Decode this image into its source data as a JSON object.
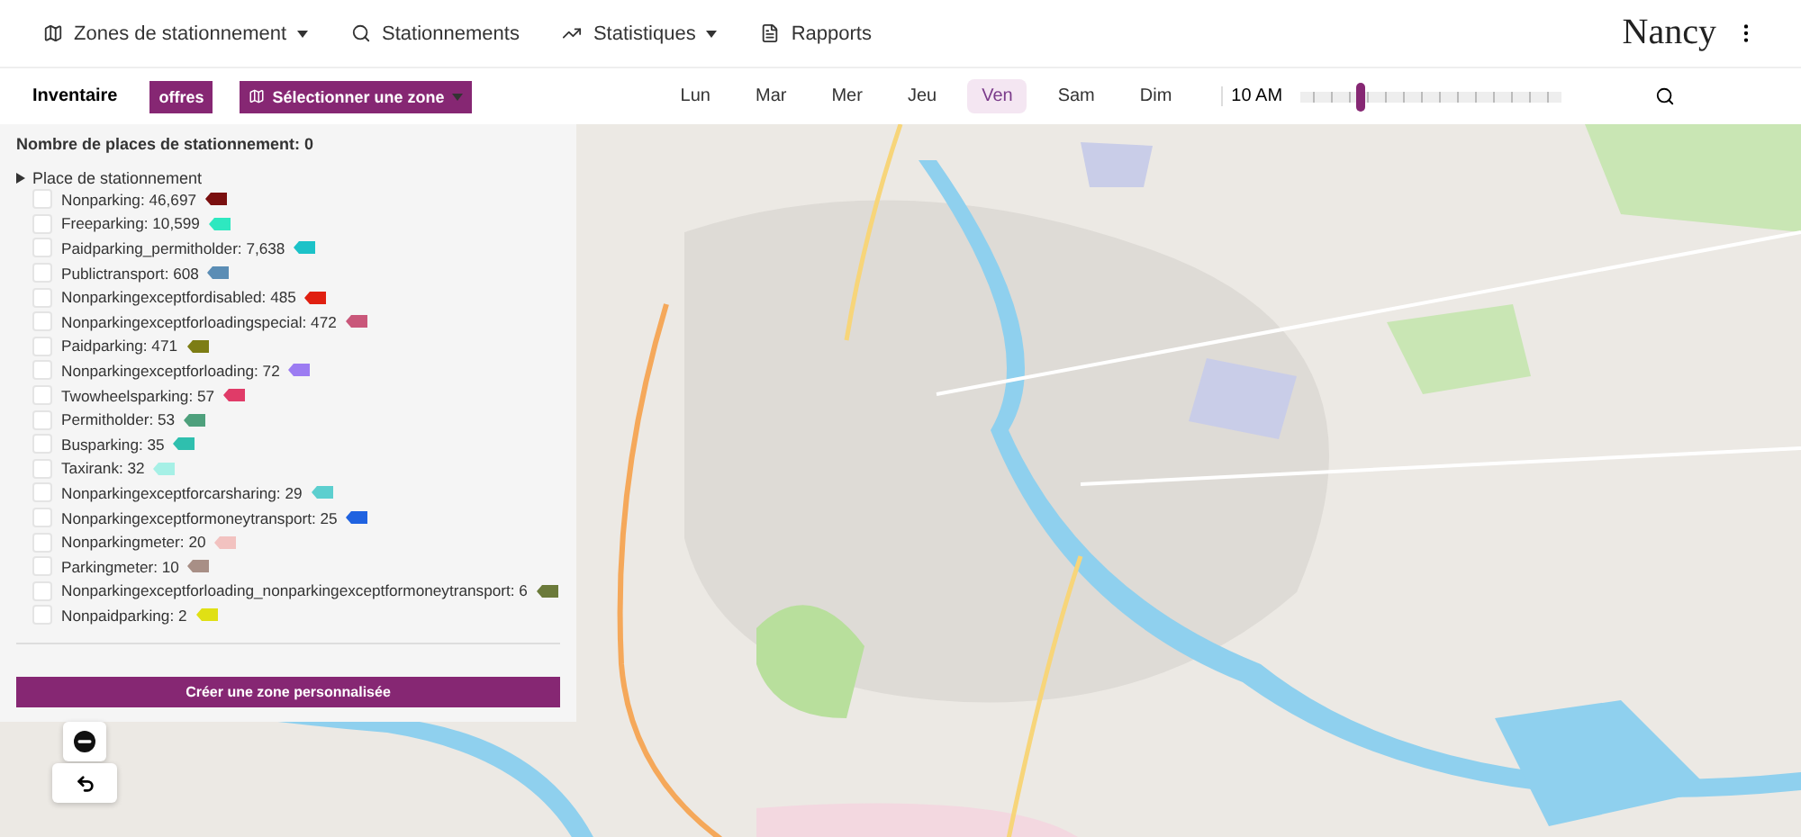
{
  "nav": {
    "items": [
      {
        "kind": "zones",
        "label": "Zones de stationnement",
        "dropdown": true
      },
      {
        "kind": "search",
        "label": "Stationnements",
        "dropdown": false
      },
      {
        "kind": "stats",
        "label": "Statistiques",
        "dropdown": true
      },
      {
        "kind": "report",
        "label": "Rapports",
        "dropdown": false
      }
    ],
    "logo": "Nancy"
  },
  "toolbar": {
    "title": "Inventaire",
    "offers_button": "offres",
    "zone_button": "Sélectionner une zone",
    "days": [
      {
        "label": "Lun",
        "selected": false
      },
      {
        "label": "Mar",
        "selected": false
      },
      {
        "label": "Mer",
        "selected": false
      },
      {
        "label": "Jeu",
        "selected": false
      },
      {
        "label": "Ven",
        "selected": true
      },
      {
        "label": "Sam",
        "selected": false
      },
      {
        "label": "Dim",
        "selected": false
      }
    ],
    "time": {
      "label": "10 AM",
      "level": 0.23
    }
  },
  "panel": {
    "count": "Nombre de places de stationnement: 0",
    "group": {
      "label": "Place de stationnement",
      "expanded": true,
      "items": [
        {
          "label": "Nonparking: 46,697",
          "checked": false,
          "color": "#7a0f0f"
        },
        {
          "label": "Freeparking: 10,599",
          "checked": false,
          "color": "#2ee8c0"
        },
        {
          "label": "Paidparking_permitholder: 7,638",
          "checked": false,
          "color": "#1cc2c8"
        },
        {
          "label": "Publictransport: 608",
          "checked": false,
          "color": "#5b8db5"
        },
        {
          "label": "Nonparkingexceptfordisabled: 485",
          "checked": false,
          "color": "#e01f10"
        },
        {
          "label": "Nonparkingexceptforloadingspecial: 472",
          "checked": false,
          "color": "#c9577a"
        },
        {
          "label": "Paidparking: 471",
          "checked": false,
          "color": "#7d7d14"
        },
        {
          "label": "Nonparkingexceptforloading: 72",
          "checked": false,
          "color": "#9c7cf2"
        },
        {
          "label": "Twowheelsparking: 57",
          "checked": false,
          "color": "#e03b68"
        },
        {
          "label": "Permitholder: 53",
          "checked": false,
          "color": "#4ea07c"
        },
        {
          "label": "Busparking: 35",
          "checked": false,
          "color": "#2fbfae"
        },
        {
          "label": "Taxirank: 32",
          "checked": false,
          "color": "#a6f0e6"
        },
        {
          "label": "Nonparkingexceptforcarsharing: 29",
          "checked": false,
          "color": "#5ccfcf"
        },
        {
          "label": "Nonparkingexceptformoneytransport: 25",
          "checked": false,
          "color": "#1f62e0"
        },
        {
          "label": "Nonparkingmeter: 20",
          "checked": false,
          "color": "#f2c2c0"
        },
        {
          "label": "Parkingmeter: 10",
          "checked": false,
          "color": "#a88f86"
        },
        {
          "label": "Nonparkingexceptforloading_nonparkingexceptformoneytransport: 6",
          "checked": false,
          "color": "#6b7a3a"
        },
        {
          "label": "Nonpaidparking: 2",
          "checked": false,
          "color": "#e0e014"
        }
      ]
    },
    "create_button": "Créer une zone personnalisée"
  }
}
